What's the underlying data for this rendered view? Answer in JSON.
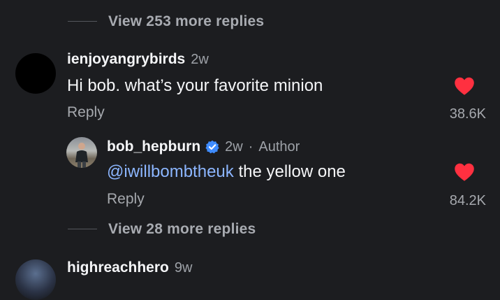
{
  "top_thread": {
    "more_replies": "View 253 more replies"
  },
  "comment1": {
    "username": "ienjoyangrybirds",
    "age": "2w",
    "text": "Hi bob. what’s your favorite minion",
    "reply_label": "Reply",
    "likes": "38.6K"
  },
  "reply1": {
    "username": "bob_hepburn",
    "age": "2w",
    "separator": "·",
    "author_label": "Author",
    "mention": "@iwillbombtheuk",
    "text": " the yellow one",
    "reply_label": "Reply",
    "likes": "84.2K"
  },
  "bottom_thread": {
    "more_replies": "View 28 more replies"
  },
  "next_comment": {
    "username": "highreachhero",
    "age": "9w"
  },
  "icons": {
    "like": "heart-icon",
    "verified": "verified-badge-icon"
  },
  "colors": {
    "background": "#1c1d20",
    "heart": "#ff3040",
    "mention": "#8cb6ff",
    "verified": "#3f8cff"
  }
}
